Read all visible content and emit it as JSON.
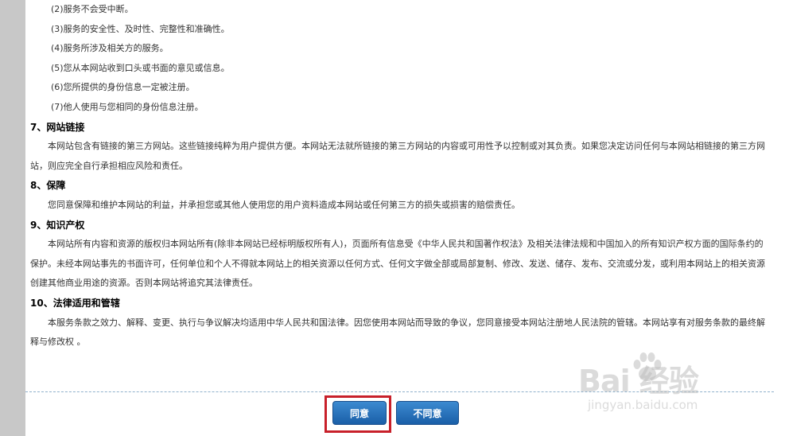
{
  "terms": {
    "items_a": [
      "(2)服务不会受中断。",
      "(3)服务的安全性、及时性、完整性和准确性。",
      "(4)服务所涉及相关方的服务。",
      "(5)您从本网站收到口头或书面的意见或信息。",
      "(6)您所提供的身份信息一定被注册。",
      "(7)他人使用与您相同的身份信息注册。"
    ],
    "sections": [
      {
        "heading": "7、网站链接",
        "body": "本网站包含有链接的第三方网站。这些链接纯粹为用户提供方便。本网站无法就所链接的第三方网站的内容或可用性予以控制或对其负责。如果您决定访问任何与本网站相链接的第三方网站，则应完全自行承担相应风险和责任。"
      },
      {
        "heading": "8、保障",
        "body": "您同意保障和维护本网站的利益，并承担您或其他人使用您的用户资料造成本网站或任何第三方的损失或损害的赔偿责任。"
      },
      {
        "heading": "9、知识产权",
        "body": "本网站所有内容和资源的版权归本网站所有(除非本网站已经标明版权所有人)，页面所有信息受《中华人民共和国著作权法》及相关法律法规和中国加入的所有知识产权方面的国际条约的保护。未经本网站事先的书面许可，任何单位和个人不得就本网站上的相关资源以任何方式、任何文字做全部或局部复制、修改、发送、储存、发布、交流或分发，或利用本网站上的相关资源创建其他商业用途的资源。否则本网站将追究其法律责任。"
      },
      {
        "heading": "10、法律适用和管辖",
        "body": "本服务条款之效力、解释、变更、执行与争议解决均适用中华人民共和国法律。因您使用本网站而导致的争议，您同意接受本网站注册地人民法院的管辖。本网站享有对服务条款的最终解释与修改权 。"
      }
    ]
  },
  "buttons": {
    "agree": "同意",
    "disagree": "不同意"
  },
  "watermark": {
    "logo_text": "Bai  经验",
    "site": "jingyan.baidu.com"
  },
  "colors": {
    "button": "#1f6bb5",
    "highlight": "#c8202a",
    "divider": "#8fb1cc",
    "left_rail": "#c8c8c8"
  }
}
